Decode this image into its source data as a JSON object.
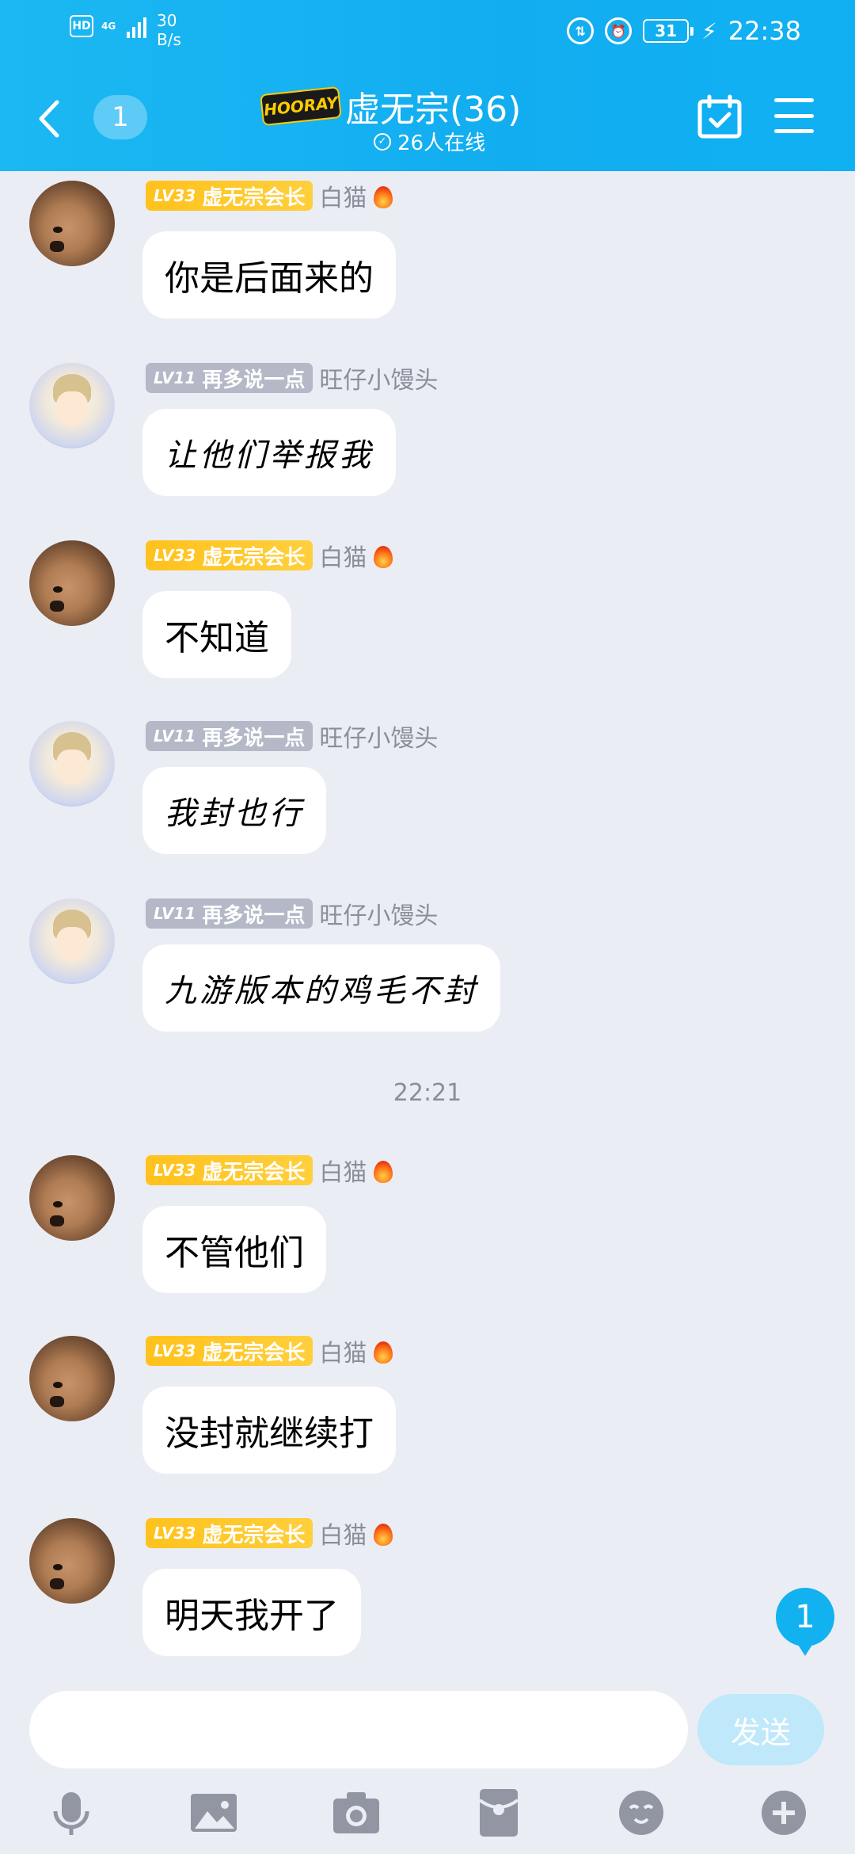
{
  "status_bar": {
    "hd": "HD",
    "network": "4G",
    "speed_value": "30",
    "speed_unit": "B/s",
    "battery": "31",
    "time": "22:38"
  },
  "header": {
    "unread_count": "1",
    "group_logo_text": "HOORAY",
    "title": "虚无宗(36)",
    "online": "26人在线"
  },
  "messages": [
    {
      "level": "LV33",
      "title": "虚无宗会长",
      "name": "白猫",
      "text": "你是后面来的"
    },
    {
      "level": "LV11",
      "title": "再多说一点",
      "name": "旺仔小馒头",
      "text": "让他们举报我"
    },
    {
      "level": "LV33",
      "title": "虚无宗会长",
      "name": "白猫",
      "text": "不知道"
    },
    {
      "level": "LV11",
      "title": "再多说一点",
      "name": "旺仔小馒头",
      "text": "我封也行"
    },
    {
      "level": "LV11",
      "title": "再多说一点",
      "name": "旺仔小馒头",
      "text": "九游版本的鸡毛不封"
    },
    {
      "level": "LV33",
      "title": "虚无宗会长",
      "name": "白猫",
      "text": "不管他们"
    },
    {
      "level": "LV33",
      "title": "虚无宗会长",
      "name": "白猫",
      "text": "没封就继续打"
    },
    {
      "level": "LV33",
      "title": "虚无宗会长",
      "name": "白猫",
      "text": "明天我开了"
    }
  ],
  "time_separator": "22:21",
  "floating_unread": "1",
  "composer": {
    "input_value": "",
    "send_label": "发送"
  },
  "toolbar_icons": [
    "microphone-icon",
    "image-icon",
    "camera-icon",
    "red-packet-icon",
    "emoji-icon",
    "plus-icon"
  ],
  "colors": {
    "header": "#12adf0",
    "background": "#ebedf5",
    "gold_badge": "#ffc21d",
    "grey_badge": "#b4b8c7",
    "send_button": "#bfe8fb"
  }
}
